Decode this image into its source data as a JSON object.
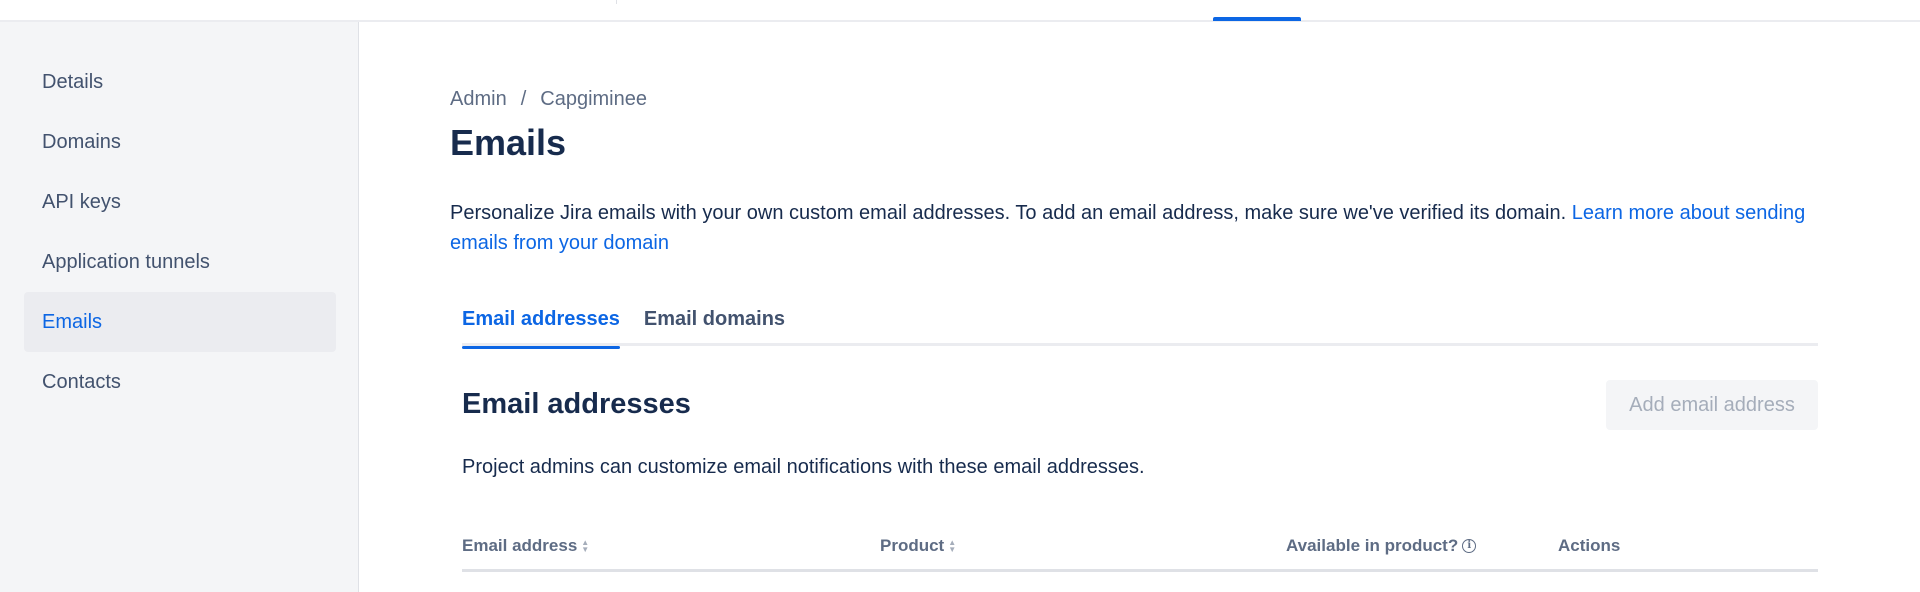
{
  "sidebar": {
    "items": [
      {
        "label": "Details"
      },
      {
        "label": "Domains"
      },
      {
        "label": "API keys"
      },
      {
        "label": "Application tunnels"
      },
      {
        "label": "Emails",
        "active": true
      },
      {
        "label": "Contacts"
      }
    ]
  },
  "breadcrumb": {
    "items": [
      "Admin",
      "Capgiminee"
    ],
    "separator": "/"
  },
  "page": {
    "title": "Emails",
    "description": "Personalize Jira emails with your own custom email addresses. To add an email address, make sure we've verified its domain. ",
    "learn_more_link": "Learn more about sending emails from your domain"
  },
  "tabs": [
    {
      "label": "Email addresses",
      "active": true
    },
    {
      "label": "Email domains"
    }
  ],
  "section": {
    "title": "Email addresses",
    "add_button": "Add email address",
    "description": "Project admins can customize email notifications with these email addresses."
  },
  "table": {
    "columns": [
      "Email address",
      "Product",
      "Available in product?",
      "Actions"
    ]
  },
  "colors": {
    "accent": "#0c66e4",
    "sidebar_bg": "#f4f5f7",
    "text": "#172b4d"
  },
  "icons": {
    "sort": "sort-icon",
    "info": "info-icon"
  }
}
